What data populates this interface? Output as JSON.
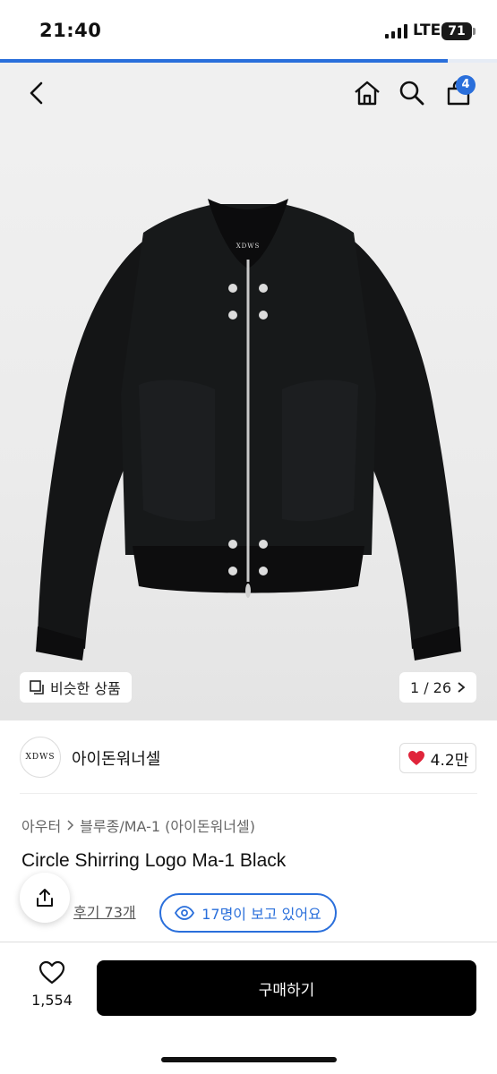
{
  "status_bar": {
    "time": "21:40",
    "network": "LTE",
    "battery": "71"
  },
  "progress": {
    "value": 0.9
  },
  "header": {
    "cart_count": "4"
  },
  "product_image": {
    "brand_label": "XDWS",
    "similar_label": "비슷한 상품",
    "counter": "1 / 26"
  },
  "brand": {
    "logo_text": "XDWS",
    "name": "아이돈워너셀",
    "likes": "4.2만"
  },
  "breadcrumb": {
    "level1": "아우터",
    "level2": "블루종/MA-1 (아이돈워너셀)"
  },
  "product": {
    "title": "Circle Shirring Logo Ma-1 Black"
  },
  "review": {
    "label": "후기 73개"
  },
  "views": {
    "label": "17명이 보고 있어요"
  },
  "bottom": {
    "wish_count": "1,554",
    "buy_label": "구매하기"
  },
  "colors": {
    "accent": "#2a6fdb",
    "heart": "#e0243a",
    "buy": "#000000"
  },
  "icons": [
    "back-icon",
    "home-icon",
    "search-icon",
    "cart-icon",
    "copy-icon",
    "chevron-right-icon",
    "heart-icon",
    "share-icon",
    "eye-icon",
    "heart-outline-icon"
  ]
}
